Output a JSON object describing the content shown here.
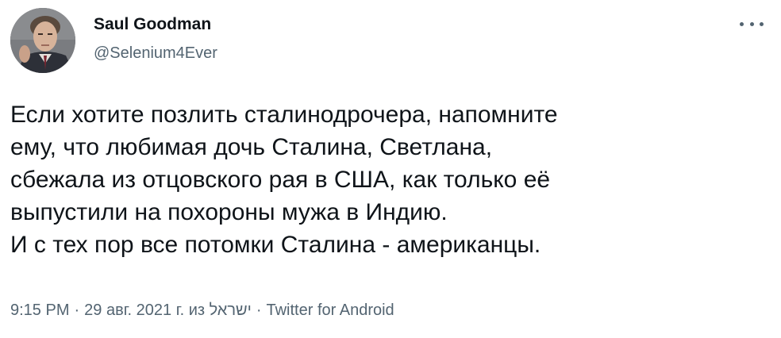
{
  "author": {
    "display_name": "Saul Goodman",
    "handle": "@Selenium4Ever",
    "avatar_icon": "profile-photo"
  },
  "more_menu": {
    "icon": "more-horizontal-icon"
  },
  "tweet": {
    "lines": [
      "Если хотите позлить сталинодрочера, напомните",
      "ему, что любимая дочь Сталина, Светлана,",
      "сбежала из отцовского рая в США, как только её",
      "выпустили на похороны мужа в Индию.",
      "И с тех пор все потомки Сталина - американцы."
    ]
  },
  "meta": {
    "time": "9:15 PM",
    "separator": "·",
    "date": "29 авг. 2021 г. из ישראל",
    "source": "Twitter for Android"
  },
  "colors": {
    "primary_text": "#0f1419",
    "secondary_text": "#536471",
    "background": "#ffffff"
  }
}
